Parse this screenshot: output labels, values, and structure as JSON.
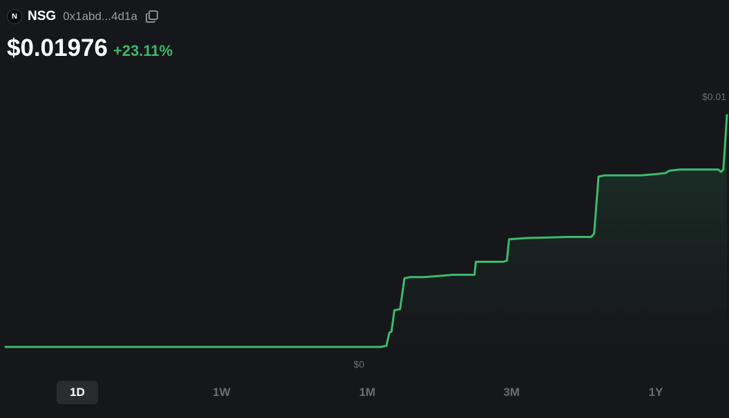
{
  "token": {
    "icon_letter": "N",
    "symbol": "NSG",
    "address": "0x1abd...4d1a",
    "icon": "copy-icon"
  },
  "price": {
    "value": "$0.01976",
    "change": "+23.11%"
  },
  "colors": {
    "background": "#16171a",
    "line": "#3dbb6e",
    "positive": "#40b66b",
    "muted": "#6c6d72",
    "active_range_bg": "#2a2b30"
  },
  "ranges": [
    {
      "label": "1D",
      "active": true
    },
    {
      "label": "1W",
      "active": false
    },
    {
      "label": "1M",
      "active": false
    },
    {
      "label": "3M",
      "active": false
    },
    {
      "label": "1Y",
      "active": false
    }
  ],
  "chart_data": {
    "type": "area",
    "max_label": "$0.01",
    "min_label": "$0",
    "ylim": [
      0,
      0.02
    ],
    "grid": false,
    "series": [
      {
        "points": [
          [
            0,
            0.0
          ],
          [
            0.52,
            0.0
          ],
          [
            0.528,
            0.0001
          ],
          [
            0.532,
            0.0012
          ],
          [
            0.535,
            0.0013
          ],
          [
            0.539,
            0.0031
          ],
          [
            0.547,
            0.0032
          ],
          [
            0.553,
            0.0058
          ],
          [
            0.56,
            0.0059
          ],
          [
            0.58,
            0.0059
          ],
          [
            0.6,
            0.006
          ],
          [
            0.62,
            0.0061
          ],
          [
            0.65,
            0.0061
          ],
          [
            0.652,
            0.0072
          ],
          [
            0.69,
            0.0072
          ],
          [
            0.695,
            0.0073
          ],
          [
            0.698,
            0.0091
          ],
          [
            0.72,
            0.0092
          ],
          [
            0.78,
            0.0093
          ],
          [
            0.812,
            0.0093
          ],
          [
            0.816,
            0.0096
          ],
          [
            0.822,
            0.0144
          ],
          [
            0.83,
            0.0145
          ],
          [
            0.88,
            0.0145
          ],
          [
            0.9,
            0.0146
          ],
          [
            0.915,
            0.0147
          ],
          [
            0.92,
            0.0149
          ],
          [
            0.935,
            0.015
          ],
          [
            0.988,
            0.015
          ],
          [
            0.992,
            0.0148
          ],
          [
            0.995,
            0.015
          ],
          [
            1.0,
            0.0196
          ]
        ]
      }
    ]
  }
}
